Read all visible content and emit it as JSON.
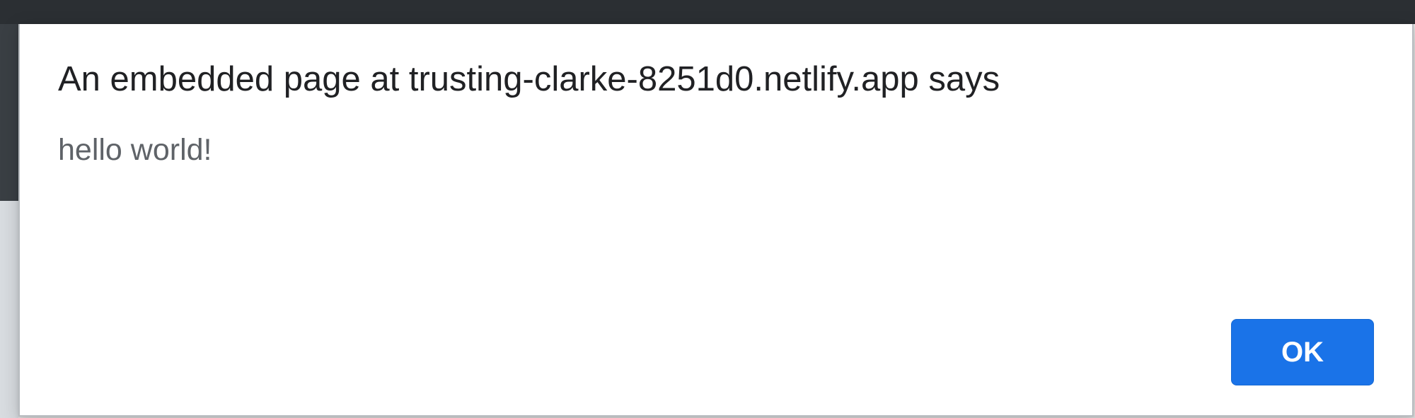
{
  "dialog": {
    "title": "An embedded page at trusting-clarke-8251d0.netlify.app says",
    "message": "hello world!",
    "ok_label": "OK"
  }
}
